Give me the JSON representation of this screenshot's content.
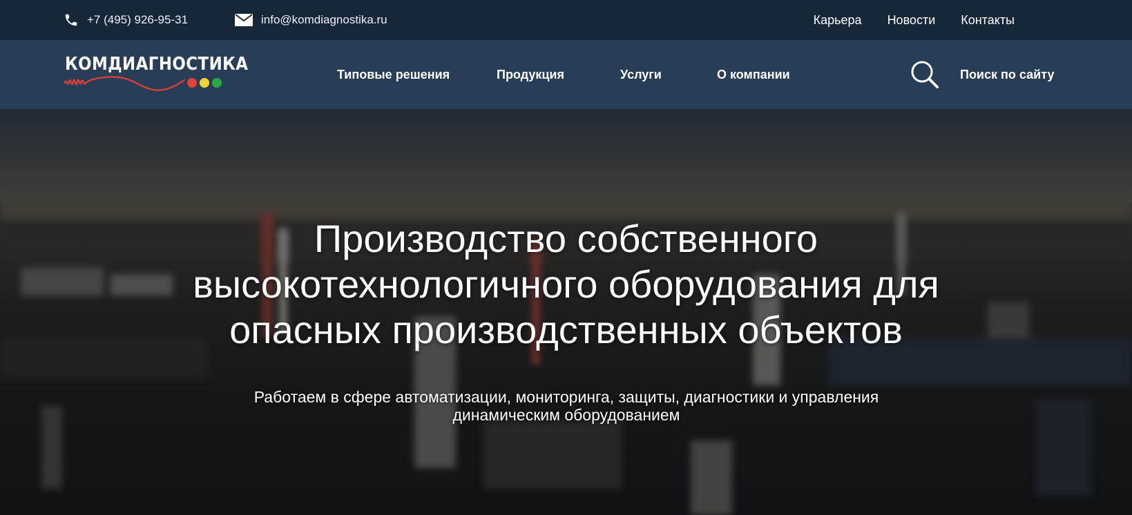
{
  "topbar": {
    "phone": "+7 (495) 926-95-31",
    "email": "info@komdiagnostika.ru",
    "links": [
      "Карьера",
      "Новости",
      "Контакты"
    ]
  },
  "header": {
    "logo_text": "КОМДИАГНОСТИКА",
    "menu": [
      "Типовые решения",
      "Продукция",
      "Услуги",
      "О компании"
    ],
    "search_label": "Поиск по сайту"
  },
  "hero": {
    "title_lines": [
      "Производство собственного",
      "высокотехнологичного оборудования для",
      "опасных производственных объектов"
    ],
    "subtitle_lines": [
      "Работаем в сфере автоматизации, мониторинга, защиты, диагностики и управления",
      "динамическим оборудованием"
    ]
  },
  "icons": {
    "phone": "phone-icon",
    "email": "envelope-icon",
    "search": "magnifier-icon"
  },
  "colors": {
    "topbar_bg": "#17273a",
    "navbar_bg": "#283e57",
    "logo_wave": "#d8403a",
    "logo_dot_red": "#e0413a",
    "logo_dot_yellow": "#f2d22e",
    "logo_dot_green": "#2aa84a"
  }
}
